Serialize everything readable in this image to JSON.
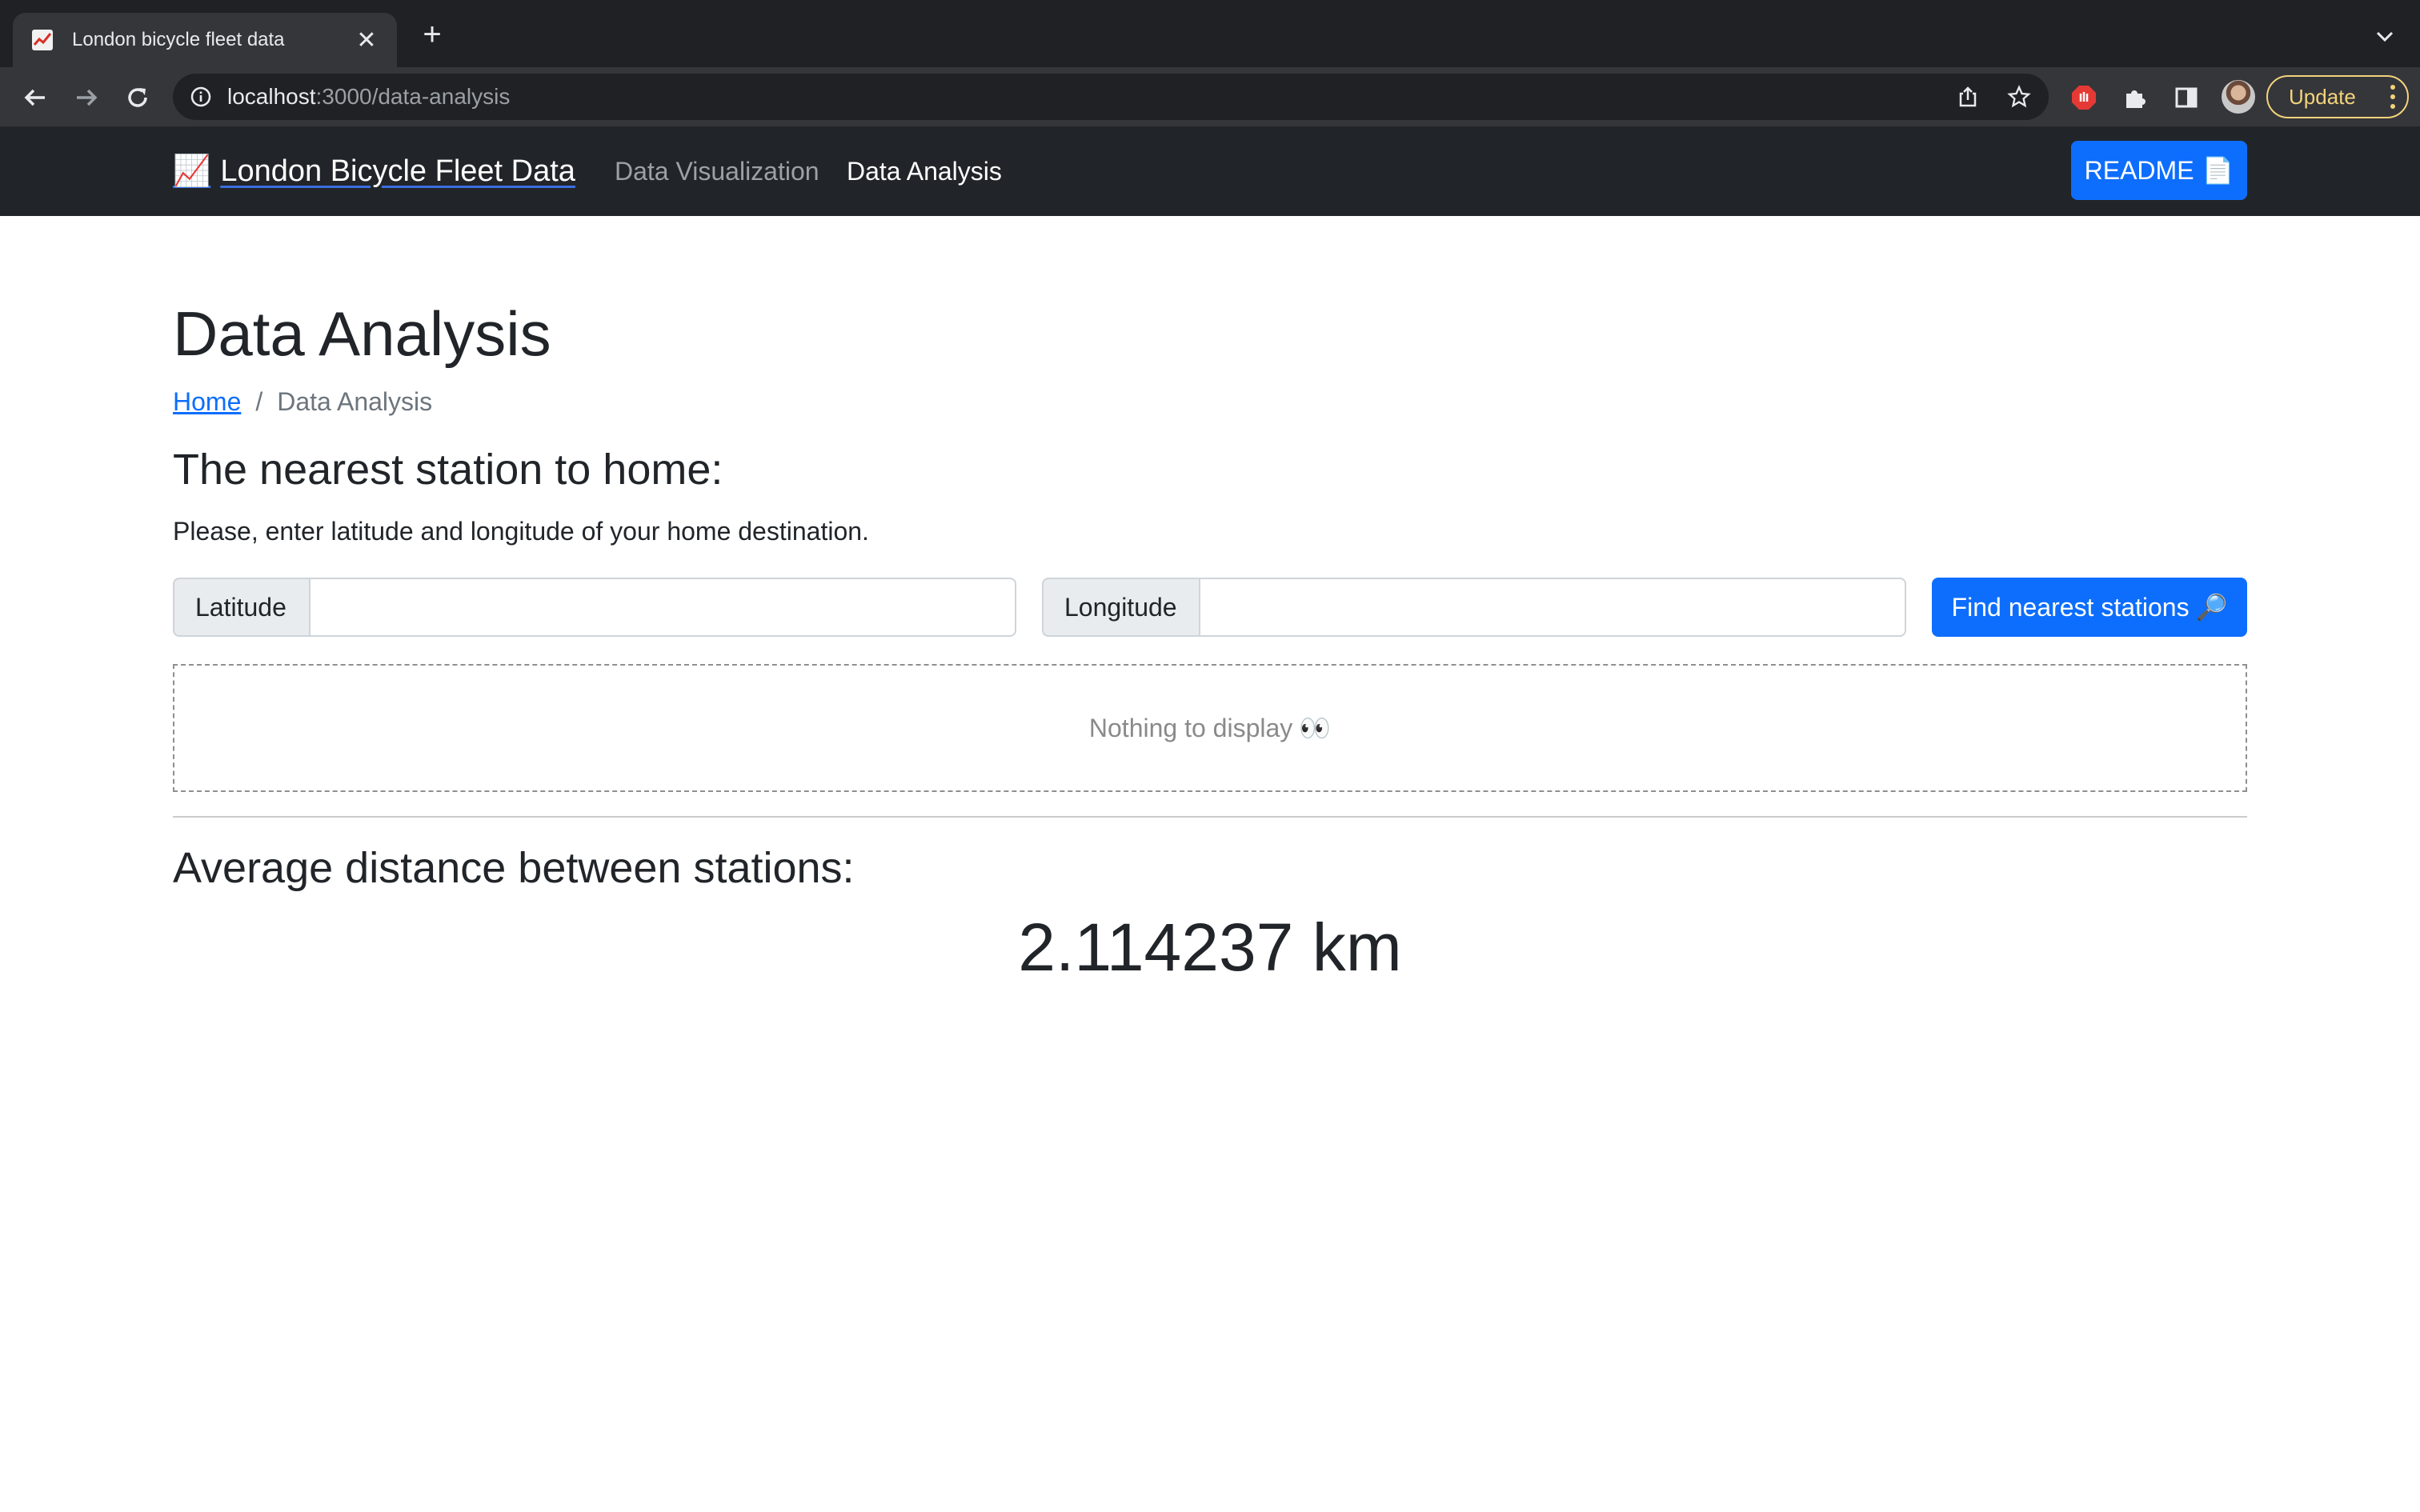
{
  "browser": {
    "tab_title": "London bicycle fleet data",
    "url_host": "localhost",
    "url_path": ":3000/data-analysis",
    "update_label": "Update"
  },
  "navbar": {
    "brand_emoji": "📈",
    "brand_label": "London Bicycle Fleet Data",
    "links": [
      {
        "label": "Data Visualization",
        "active": false
      },
      {
        "label": "Data Analysis",
        "active": true
      }
    ],
    "readme_label": "README",
    "readme_emoji": "📄"
  },
  "page": {
    "title": "Data Analysis",
    "breadcrumb": {
      "home": "Home",
      "separator": "/",
      "current": "Data Analysis"
    }
  },
  "nearest": {
    "heading": "The nearest station to home:",
    "instructions": "Please, enter latitude and longitude of your home destination.",
    "latitude_label": "Latitude",
    "latitude_value": "",
    "longitude_label": "Longitude",
    "longitude_value": "",
    "button_label": "Find nearest stations",
    "button_emoji": "🔎",
    "empty_text": "Nothing to display",
    "empty_emoji": "👀"
  },
  "average": {
    "heading": "Average distance between stations:",
    "value": "2.114237 km"
  },
  "colors": {
    "primary": "#0d6efd",
    "navbar_bg": "#212529",
    "chrome_bg": "#35363a",
    "update_accent": "#f3d37b"
  }
}
